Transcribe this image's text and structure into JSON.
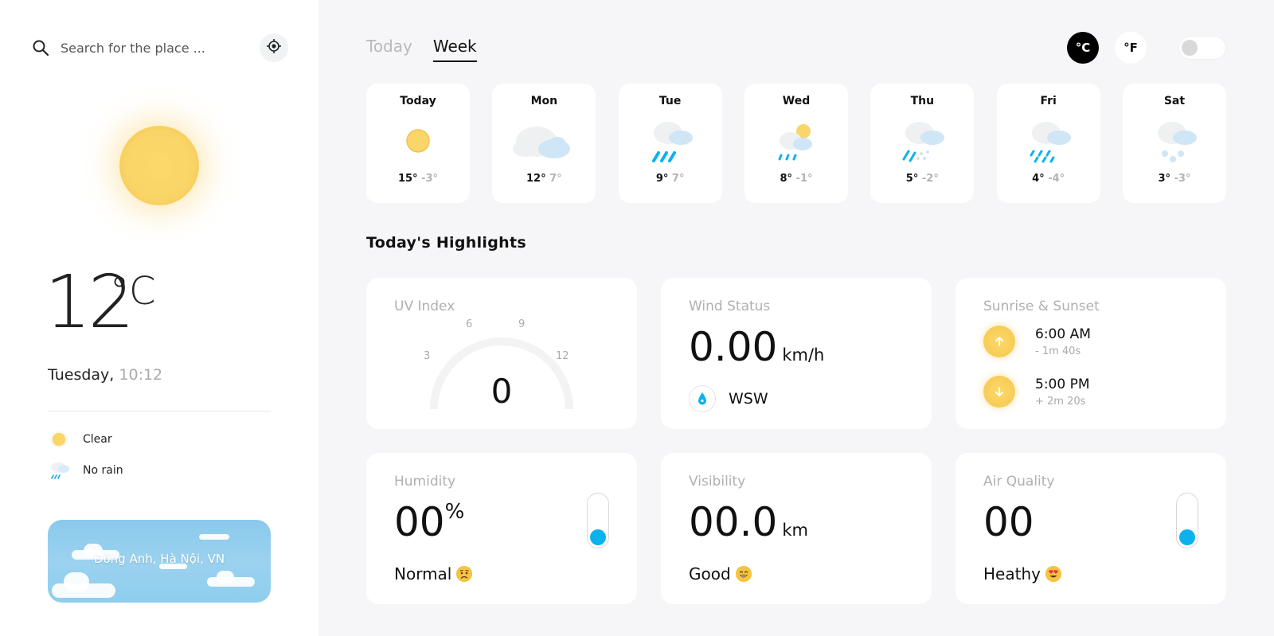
{
  "search": {
    "placeholder": "Search for the place ..."
  },
  "current": {
    "temperature": "12",
    "unit": "°C",
    "day": "Tuesday,",
    "time": "10:12",
    "conditions": [
      {
        "icon": "sun-icon",
        "label": "Clear"
      },
      {
        "icon": "rain-cloud-icon",
        "label": "No rain"
      }
    ],
    "location": "Đông Anh, Hà Nội, VN"
  },
  "tabs": [
    {
      "label": "Today",
      "active": false
    },
    {
      "label": "Week",
      "active": true
    }
  ],
  "units": {
    "celsius": "°C",
    "fahrenheit": "°F",
    "selected": "celsius"
  },
  "week": [
    {
      "day": "Today",
      "icon": "sun-icon",
      "high": "15°",
      "low": "-3°"
    },
    {
      "day": "Mon",
      "icon": "cloudy-icon",
      "high": "12°",
      "low": "7°"
    },
    {
      "day": "Tue",
      "icon": "heavy-rain-icon",
      "high": "9°",
      "low": "7°"
    },
    {
      "day": "Wed",
      "icon": "sun-rain-icon",
      "high": "8°",
      "low": "-1°"
    },
    {
      "day": "Thu",
      "icon": "sleet-icon",
      "high": "5°",
      "low": "-2°"
    },
    {
      "day": "Fri",
      "icon": "rain-icon",
      "high": "4°",
      "low": "-4°"
    },
    {
      "day": "Sat",
      "icon": "snow-icon",
      "high": "3°",
      "low": "-3°"
    }
  ],
  "highlights": {
    "title": "Today's Highlights",
    "uv": {
      "title": "UV Index",
      "value": "0",
      "ticks": [
        "3",
        "6",
        "9",
        "12"
      ]
    },
    "wind": {
      "title": "Wind Status",
      "value": "0.00",
      "unit": "km/h",
      "direction": "WSW"
    },
    "sun": {
      "title": "Sunrise & Sunset",
      "sunrise": "6:00 AM",
      "sunrise_delta": "- 1m 40s",
      "sunset": "5:00 PM",
      "sunset_delta": "+ 2m 20s"
    },
    "humidity": {
      "title": "Humidity",
      "value": "00",
      "unit": "%",
      "status": "Normal",
      "status_icon": "worried-face-icon",
      "level": 0
    },
    "visibility": {
      "title": "Visibility",
      "value": "00.0",
      "unit": "km",
      "status": "Good",
      "status_icon": "grinning-face-icon"
    },
    "air": {
      "title": "Air Quality",
      "value": "00",
      "status": "Heathy",
      "status_icon": "heart-eyes-face-icon",
      "level": 0
    }
  },
  "colors": {
    "accent_blue": "#0cb2ed",
    "sun_yellow": "#f9d466",
    "background": "#f6f6f8"
  }
}
